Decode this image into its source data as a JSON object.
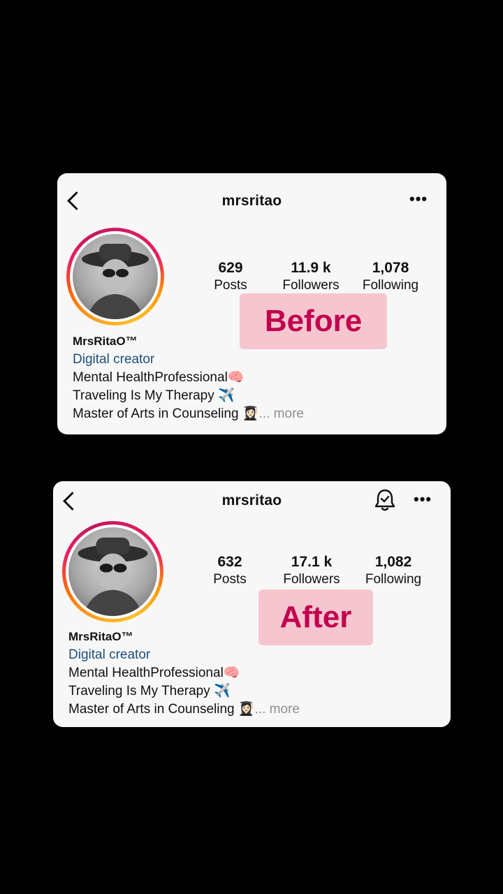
{
  "cards": [
    {
      "label": "Before",
      "username": "mrsritao",
      "stats": [
        {
          "value": "629",
          "label": "Posts"
        },
        {
          "value": "11.9 k",
          "label": "Followers"
        },
        {
          "value": "1,078",
          "label": "Following"
        }
      ],
      "display_name": "MrsRitaO™",
      "category": "Digital creator",
      "bio_lines": [
        "Mental HealthProfessional🧠",
        "Traveling Is My Therapy ✈️",
        "Master of Arts in Counseling 👩🏻‍🎓"
      ],
      "more": "... more"
    },
    {
      "label": "After",
      "username": "mrsritao",
      "stats": [
        {
          "value": "632",
          "label": "Posts"
        },
        {
          "value": "17.1 k",
          "label": "Followers"
        },
        {
          "value": "1,082",
          "label": "Following"
        }
      ],
      "display_name": "MrsRitaO™",
      "category": "Digital creator",
      "bio_lines": [
        "Mental HealthProfessional🧠",
        "Traveling Is My Therapy ✈️",
        "Master of Arts in Counseling 👩🏻‍🎓"
      ],
      "more": "... more"
    }
  ],
  "icons": {
    "back": "back-icon",
    "more": "more-options-icon",
    "bell": "notification-bell-icon"
  },
  "colors": {
    "background": "#000000",
    "card": "#f7f7f7",
    "badge_bg": "#f5c6cf",
    "badge_text": "#c2004f",
    "category_link": "#1c4e7a"
  }
}
